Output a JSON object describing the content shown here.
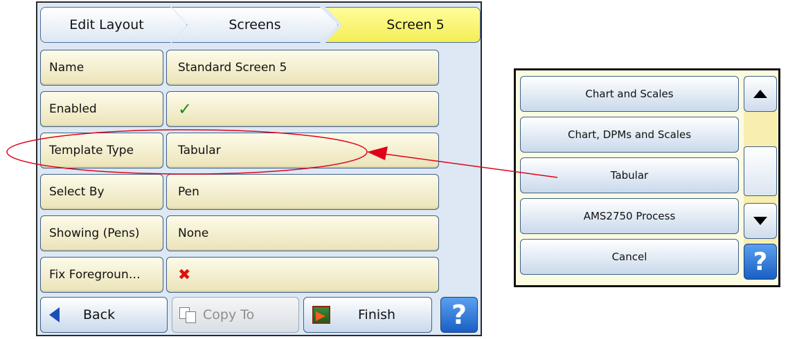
{
  "breadcrumb": {
    "items": [
      "Edit Layout",
      "Screens",
      "Screen 5"
    ]
  },
  "rows": [
    {
      "label": "Name",
      "value": "Standard Screen 5"
    },
    {
      "label": "Enabled",
      "value": "✓"
    },
    {
      "label": "Template Type",
      "value": "Tabular"
    },
    {
      "label": "Select By",
      "value": "Pen"
    },
    {
      "label": "Showing (Pens)",
      "value": "None"
    },
    {
      "label": "Fix Foregroun…",
      "value": "✖"
    }
  ],
  "buttons": {
    "back": "Back",
    "copy_to": "Copy To",
    "finish": "Finish",
    "help": "?"
  },
  "popup": {
    "options": [
      "Chart and Scales",
      "Chart, DPMs and Scales",
      "Tabular",
      "AMS2750 Process",
      "Cancel"
    ],
    "help": "?"
  },
  "colors": {
    "active_crumb": "#f3ee55",
    "row_fill": "#f3ecc8",
    "annotation": "#e0001a",
    "help_button": "#1a5fc4"
  },
  "icons": {
    "back": "triangle-left",
    "copy": "copy-pages",
    "finish": "door-arrow",
    "enabled": "checkmark",
    "fix_foreground": "cross",
    "scroll_up": "triangle-up",
    "scroll_down": "triangle-down"
  }
}
